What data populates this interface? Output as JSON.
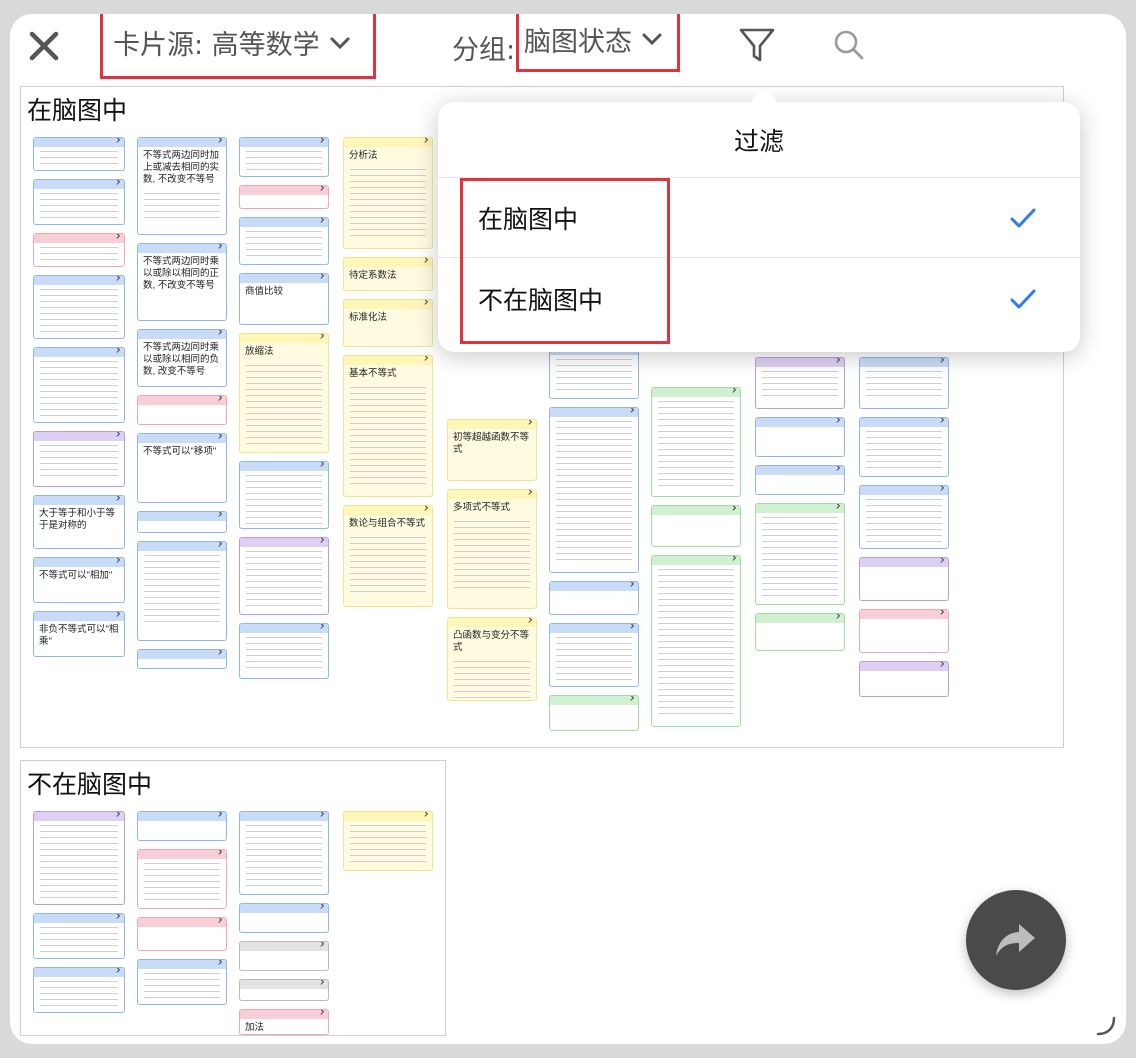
{
  "topbar": {
    "card_source": "卡片源: 高等数学",
    "group_prefix": "分组:",
    "group_value": "脑图状态"
  },
  "groups": [
    {
      "title": "在脑图中"
    },
    {
      "title": "不在脑图中"
    }
  ],
  "cards": {
    "c1": "不等式两边同时加上或减去相同的实数, 不改变不等号",
    "c2": "不等式两边同时乘以或除以相同的正数, 不改变不等号",
    "c3": "不等式两边同时乘以或除以相同的负数, 改变不等号",
    "c4": "不等式可以\"移项\"",
    "c5": "大于等于和小于等于是对称的",
    "c6": "不等式可以\"相加\"",
    "c7": "非负不等式可以\"相乘\"",
    "c8": "商值比较",
    "c9": "放缩法",
    "c10": "分析法",
    "c11": "待定系数法",
    "c12": "标准化法",
    "c13": "基本不等式",
    "c14": "初等超越函数不等式",
    "c15": "多项式不等式",
    "c16": "数论与组合不等式",
    "c17": "凸函数与变分不等式",
    "c18": "加法"
  },
  "filter": {
    "title": "过滤",
    "options": [
      {
        "label": "在脑图中",
        "checked": true
      },
      {
        "label": "不在脑图中",
        "checked": true
      }
    ]
  },
  "colors": {
    "accent": "#2f7bf5",
    "highlight": "#e0323f",
    "fab": "#4a4a4a"
  }
}
